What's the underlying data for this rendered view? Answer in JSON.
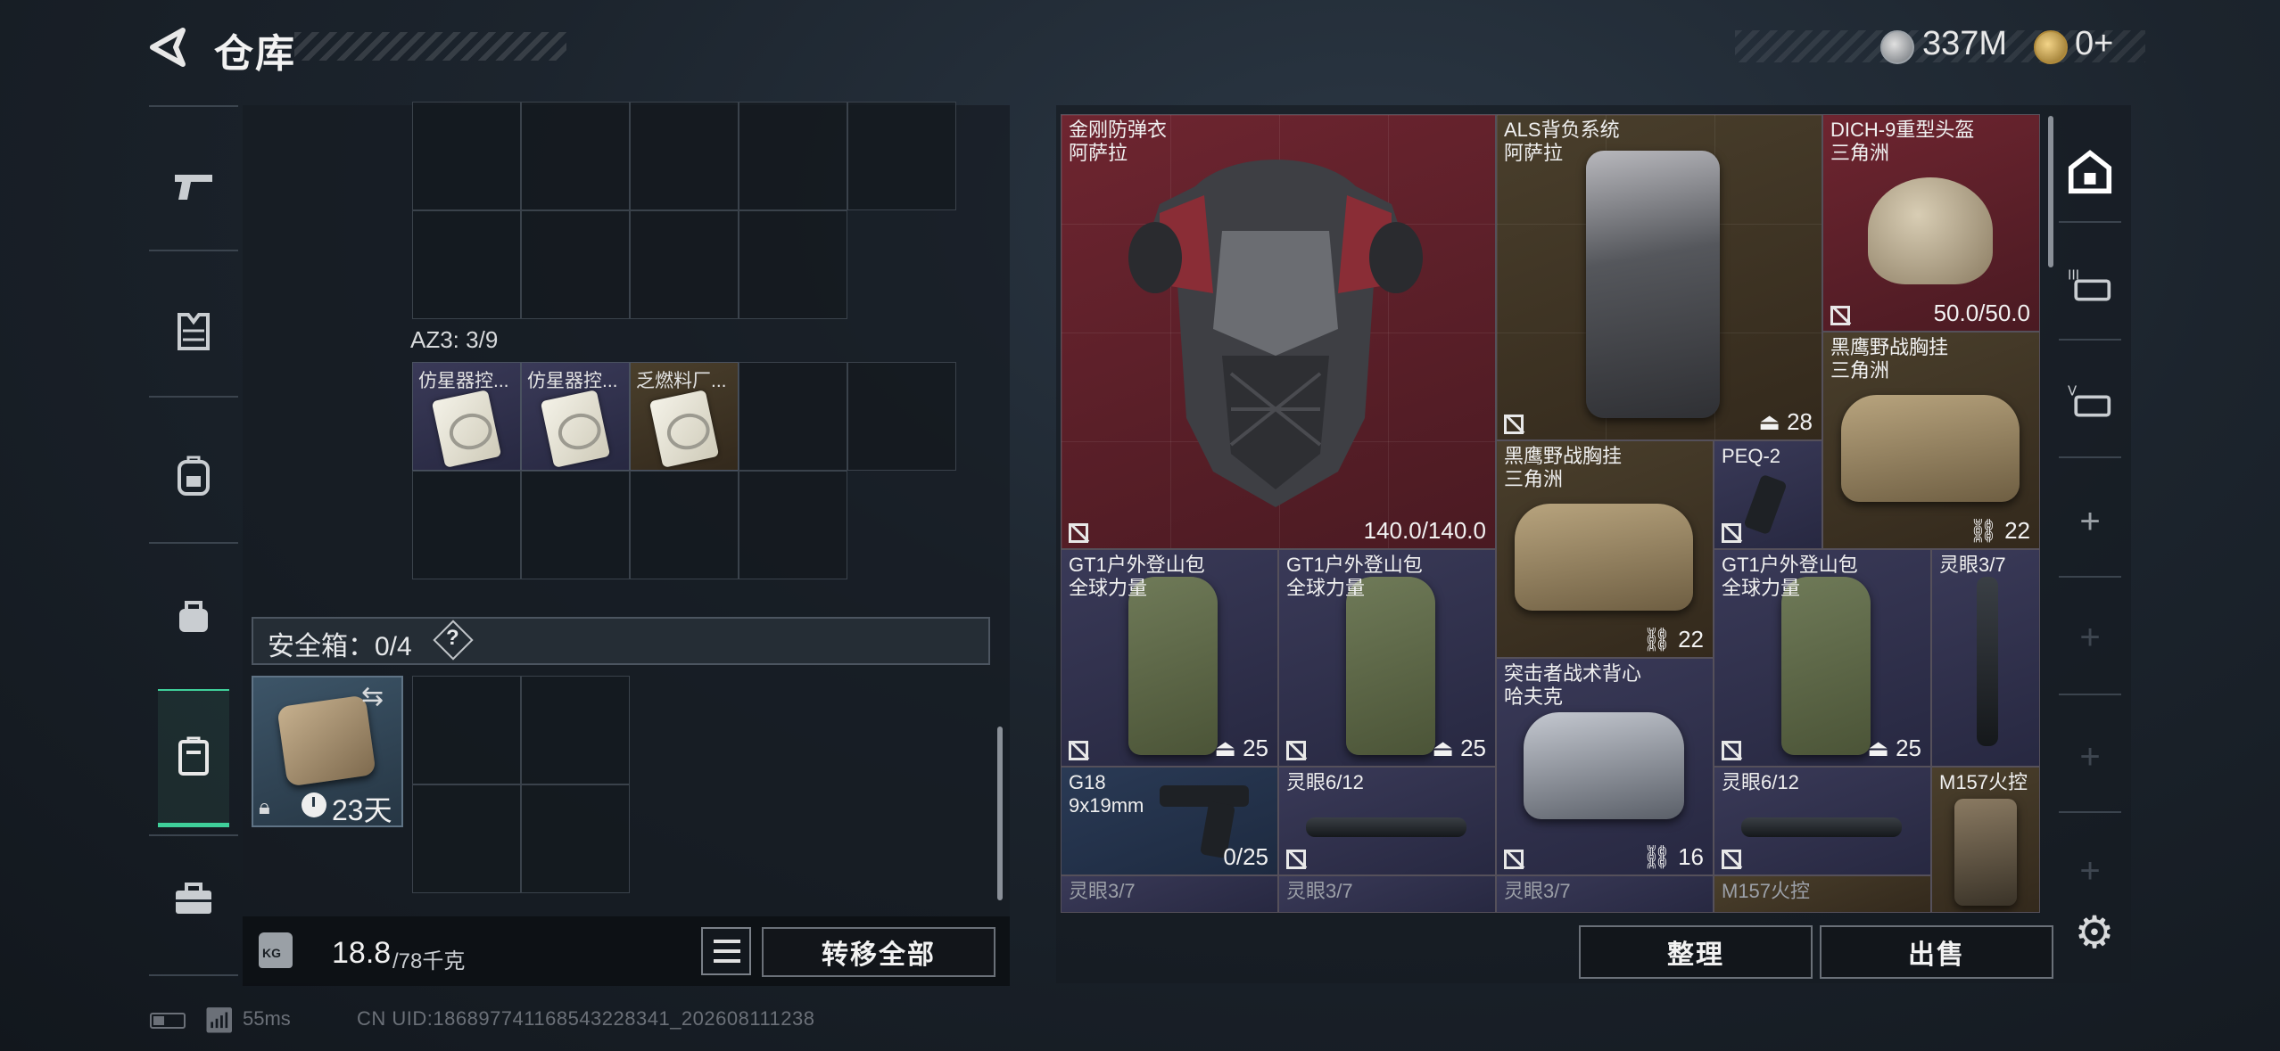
{
  "header": {
    "title": "仓库",
    "currency": [
      {
        "icon": "silver-coin-icon",
        "value": "337M"
      },
      {
        "icon": "gold-coin-icon",
        "value": "0+"
      }
    ]
  },
  "left_sidebar": {
    "items": [
      {
        "icon": "pistol-icon",
        "active": false
      },
      {
        "icon": "vest-icon",
        "active": false
      },
      {
        "icon": "backpack-icon",
        "active": false
      },
      {
        "icon": "bag-icon",
        "active": false
      },
      {
        "icon": "safe-case-icon",
        "active": true
      },
      {
        "icon": "briefcase-icon",
        "active": false
      }
    ]
  },
  "storage": {
    "az3_label": "AZ3: 3/9",
    "az3_items": [
      {
        "name": "仿星器控...",
        "rarity": "purple"
      },
      {
        "name": "仿星器控...",
        "rarity": "purple"
      },
      {
        "name": "乏燃料厂...",
        "rarity": "gold"
      }
    ],
    "safe_box_label": "安全箱：0/4",
    "safe_box_help": "?",
    "safe_case_days": "23天"
  },
  "weight": {
    "current": "18.8",
    "max": "/78千克",
    "kg_label": "KG"
  },
  "buttons": {
    "transfer_all": "转移全部",
    "sort": "整理",
    "sell": "出售"
  },
  "loot_items": [
    {
      "name": "金刚防弹衣",
      "sub": "阿萨拉",
      "value": "140.0/140.0",
      "rarity": "red"
    },
    {
      "name": "ALS背负系统",
      "sub": "阿萨拉",
      "value": "28",
      "rarity": "gold"
    },
    {
      "name": "DICH-9重型头盔",
      "sub": "三角洲",
      "value": "50.0/50.0",
      "rarity": "red"
    },
    {
      "name": "黑鹰野战胸挂",
      "sub": "三角洲",
      "value": "22",
      "rarity": "gold"
    },
    {
      "name": "黑鹰野战胸挂",
      "sub": "三角洲",
      "value": "22",
      "rarity": "gold"
    },
    {
      "name": "PEQ-2",
      "sub": "",
      "value": "",
      "rarity": "purple"
    },
    {
      "name": "GT1户外登山包",
      "sub": "全球力量",
      "value": "25",
      "rarity": "purple"
    },
    {
      "name": "GT1户外登山包",
      "sub": "全球力量",
      "value": "25",
      "rarity": "purple"
    },
    {
      "name": "突击者战术背心",
      "sub": "哈夫克",
      "value": "16",
      "rarity": "purple"
    },
    {
      "name": "GT1户外登山包",
      "sub": "全球力量",
      "value": "25",
      "rarity": "purple"
    },
    {
      "name": "灵眼3/7",
      "sub": "",
      "value": "",
      "rarity": "purple"
    },
    {
      "name": "G18",
      "sub": "9x19mm",
      "value": "0/25",
      "rarity": "blue"
    },
    {
      "name": "灵眼6/12",
      "sub": "",
      "value": "",
      "rarity": "purple"
    },
    {
      "name": "灵眼6/12",
      "sub": "",
      "value": "",
      "rarity": "purple"
    },
    {
      "name": "M157火控",
      "sub": "",
      "value": "",
      "rarity": "gold"
    },
    {
      "name": "灵眼3/7",
      "sub": "",
      "value": "",
      "rarity": "purple"
    },
    {
      "name": "灵眼3/7",
      "sub": "",
      "value": "",
      "rarity": "purple"
    },
    {
      "name": "灵眼3/7",
      "sub": "",
      "value": "",
      "rarity": "purple"
    },
    {
      "name": "M157火控",
      "sub": "",
      "value": "",
      "rarity": "gold"
    }
  ],
  "right_sidebar": {
    "items": [
      "home-case-icon",
      "tier3-vest-icon",
      "tier5-vest-icon",
      "plus-icon",
      "plus-icon",
      "plus-icon",
      "plus-icon"
    ]
  },
  "status_bar": {
    "ping": "55ms",
    "uid": "CN UID:18689774116854322834​1_202608111238"
  }
}
